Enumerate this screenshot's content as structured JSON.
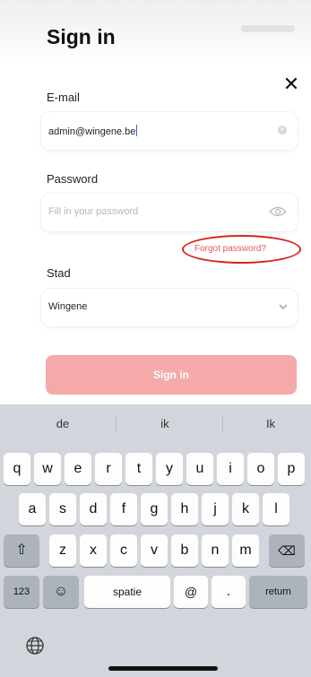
{
  "header": {
    "title": "Sign in",
    "close_icon": "close-icon"
  },
  "form": {
    "email_label": "E-mail",
    "email_value": "admin@wingene.be",
    "password_label": "Password",
    "password_placeholder": "Fill in your password",
    "forgot_password": "Forgot password?",
    "city_label": "Stad",
    "city_value": "Wingene",
    "signin_button": "Sign in"
  },
  "colors": {
    "accent": "#e2595b",
    "button_disabled": "#f5a9a8",
    "annotation_ring": "#d9231e",
    "keyboard_bg": "#d2d5db"
  },
  "keyboard": {
    "suggestions": [
      "de",
      "ik",
      "Ik"
    ],
    "row1": [
      "q",
      "w",
      "e",
      "r",
      "t",
      "y",
      "u",
      "i",
      "o",
      "p"
    ],
    "row2": [
      "a",
      "s",
      "d",
      "f",
      "g",
      "h",
      "j",
      "k",
      "l"
    ],
    "row3": [
      "z",
      "x",
      "c",
      "v",
      "b",
      "n",
      "m"
    ],
    "numbers_key": "123",
    "space_key": "spatie",
    "at_key": "@",
    "dot_key": ".",
    "return_key": "return",
    "icons": [
      "shift-icon",
      "backspace-icon",
      "emoji-icon",
      "globe-icon"
    ]
  }
}
